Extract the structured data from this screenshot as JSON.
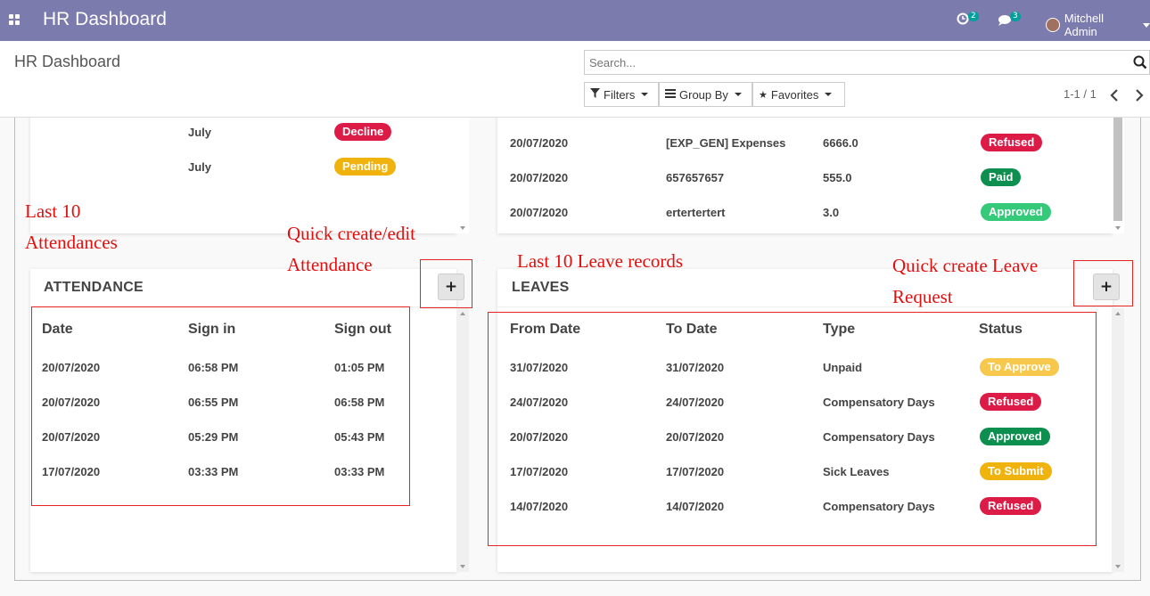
{
  "navbar": {
    "title": "HR Dashboard",
    "activity_count": "2",
    "messages_count": "3",
    "user_name": "Mitchell Admin"
  },
  "control_panel": {
    "breadcrumb": "HR Dashboard",
    "search_placeholder": "Search...",
    "filters_label": "Filters",
    "group_by_label": "Group By",
    "favorites_label": "Favorites",
    "pager": "1-1 / 1"
  },
  "top_left_rows": [
    {
      "month": "July",
      "status": "Decline",
      "color": "red"
    },
    {
      "month": "July",
      "status": "Pending",
      "color": "yellow"
    }
  ],
  "expenses_rows": [
    {
      "date": "20/07/2020",
      "name": "[EXP_GEN] Expenses",
      "amount": "6666.0",
      "status": "Refused",
      "color": "red"
    },
    {
      "date": "20/07/2020",
      "name": "657657657",
      "amount": "555.0",
      "status": "Paid",
      "color": "green-dark"
    },
    {
      "date": "20/07/2020",
      "name": "ertertertert",
      "amount": "3.0",
      "status": "Approved",
      "color": "green"
    }
  ],
  "attendance": {
    "title": "ATTENDANCE",
    "add_label": "+",
    "headers": [
      "Date",
      "Sign in",
      "Sign out"
    ],
    "rows": [
      [
        "20/07/2020",
        "06:58 PM",
        "01:05 PM"
      ],
      [
        "20/07/2020",
        "06:55 PM",
        "06:58 PM"
      ],
      [
        "20/07/2020",
        "05:29 PM",
        "05:43 PM"
      ],
      [
        "17/07/2020",
        "03:33 PM",
        "03:33 PM"
      ]
    ]
  },
  "leaves": {
    "title": "LEAVES",
    "add_label": "+",
    "headers": [
      "From Date",
      "To Date",
      "Type",
      "Status"
    ],
    "rows": [
      {
        "from": "31/07/2020",
        "to": "31/07/2020",
        "type": "Unpaid",
        "status": "To Approve",
        "color": "light-yellow"
      },
      {
        "from": "24/07/2020",
        "to": "24/07/2020",
        "type": "Compensatory Days",
        "status": "Refused",
        "color": "red"
      },
      {
        "from": "20/07/2020",
        "to": "20/07/2020",
        "type": "Compensatory Days",
        "status": "Approved",
        "color": "green-dark"
      },
      {
        "from": "17/07/2020",
        "to": "17/07/2020",
        "type": "Sick Leaves",
        "status": "To Submit",
        "color": "yellow"
      },
      {
        "from": "14/07/2020",
        "to": "14/07/2020",
        "type": "Compensatory Days",
        "status": "Refused",
        "color": "red"
      }
    ]
  },
  "annotations": {
    "last10_attendances_l1": "Last 10",
    "last10_attendances_l2": "Attendances",
    "quick_attendance_l1": "Quick create/edit",
    "quick_attendance_l2": "Attendance",
    "last10_leaves": "Last 10 Leave records",
    "quick_leave_l1": "Quick create Leave",
    "quick_leave_l2": "Request"
  },
  "colors": {
    "navbar": "#7c7bad",
    "annotation_red": "#e0100f"
  }
}
